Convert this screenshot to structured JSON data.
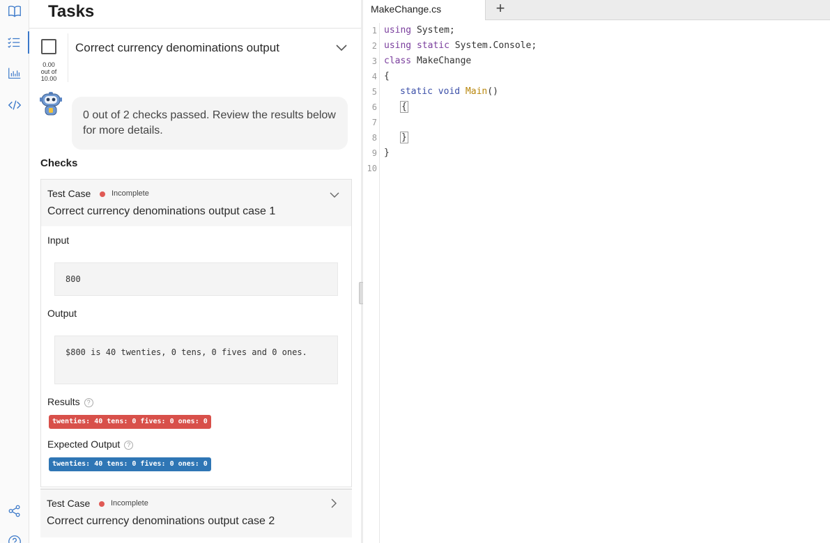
{
  "rail": {
    "icons": [
      "book-icon",
      "task-list-icon",
      "bar-chart-icon",
      "code-icon",
      "share-icon",
      "help-icon"
    ]
  },
  "tasks": {
    "title": "Tasks",
    "task": {
      "name": "Correct currency denominations output",
      "score_value": "0.00",
      "score_out_of": "out of",
      "score_max": "10.00"
    },
    "feedback": "0 out of 2 checks passed. Review the results below for more details.",
    "checks_label": "Checks",
    "cases": [
      {
        "type": "Test Case",
        "status": "Incomplete",
        "name": "Correct currency denominations output case 1",
        "input_label": "Input",
        "input_value": "800",
        "output_label": "Output",
        "output_value": "$800 is 40 twenties, 0 tens, 0 fives and 0 ones.",
        "results_label": "Results",
        "results_value": "twenties: 40 tens: 0 fives: 0 ones: 0",
        "expected_label": "Expected Output",
        "expected_value": "twenties: 40 tens: 0 fives: 0 ones: 0"
      },
      {
        "type": "Test Case",
        "status": "Incomplete",
        "name": "Correct currency denominations output case 2"
      }
    ],
    "help_glyph": "?"
  },
  "editor": {
    "tab_label": "MakeChange.cs",
    "new_tab_glyph": "+",
    "line_numbers": [
      "1",
      "2",
      "3",
      "4",
      "5",
      "6",
      "7",
      "8",
      "9",
      "10"
    ],
    "code": {
      "l1_kw": "using",
      "l1_rest": " System;",
      "l2_kw": "using",
      "l2_kw2": " static",
      "l2_rest": " System.Console;",
      "l3_kw": "class",
      "l3_rest": " MakeChange",
      "l4": "{",
      "l5_kw": "static",
      "l5_kw2": " void",
      "l5_fn": " Main",
      "l5_rest": "()",
      "l6": "{",
      "l8": "}",
      "l9": "}"
    }
  },
  "colors": {
    "accent": "#3a78c9",
    "status_incomplete": "#e05a55",
    "badge_result": "#d8504a",
    "badge_expected": "#2f76b5"
  }
}
